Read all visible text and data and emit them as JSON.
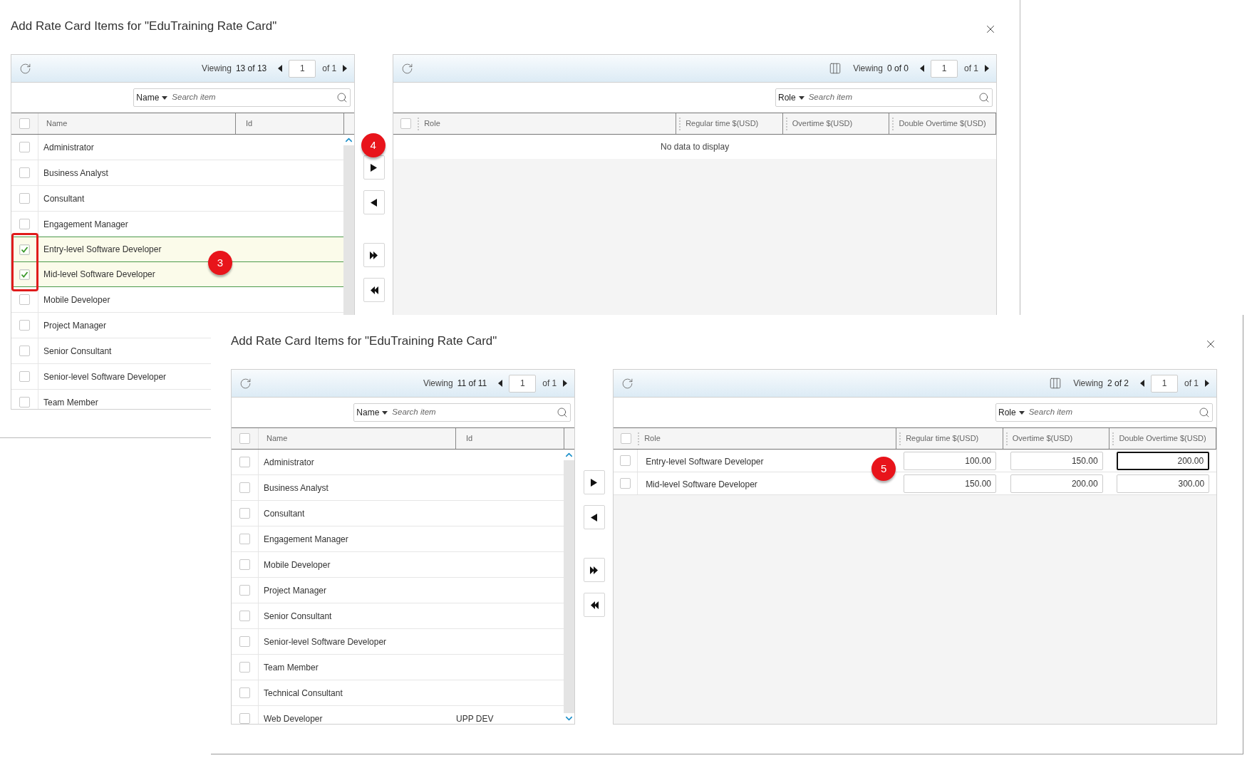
{
  "dialogs": [
    {
      "title": "Add Rate Card Items for \"EduTraining Rate Card\"",
      "selection_outline": true,
      "left_grid": {
        "all_checked": false,
        "viewing": "Viewing",
        "count": "13 of 13",
        "page": "1",
        "page_total": "of 1",
        "search": {
          "filter": "Name",
          "placeholder": "Search item"
        },
        "columns": [
          "Name",
          "Id"
        ],
        "callout": "3",
        "rows": [
          {
            "name": "Administrator",
            "checked": false
          },
          {
            "name": "Business Analyst",
            "checked": false
          },
          {
            "name": "Consultant",
            "checked": false
          },
          {
            "name": "Engagement Manager",
            "checked": false
          },
          {
            "name": "Entry-level Software Developer",
            "checked": true
          },
          {
            "name": "Mid-level Software Developer",
            "checked": true
          },
          {
            "name": "Mobile Developer",
            "checked": false
          },
          {
            "name": "Project Manager",
            "checked": false
          },
          {
            "name": "Senior Consultant",
            "checked": false
          },
          {
            "name": "Senior-level Software Developer",
            "checked": false
          },
          {
            "name": "Team Member",
            "checked": false
          }
        ]
      },
      "move_buttons": [
        {
          "kind": "add",
          "callout": "4"
        },
        {
          "kind": "remove"
        },
        {
          "kind": "add-all"
        },
        {
          "kind": "remove-all"
        }
      ],
      "right_grid": {
        "all_checked": false,
        "viewing": "Viewing",
        "count": "0 of 0",
        "page": "1",
        "page_total": "of 1",
        "search": {
          "filter": "Role",
          "placeholder": "Search item"
        },
        "columns": [
          "Role",
          "Regular time $(USD)",
          "Overtime $(USD)",
          "Double Overtime $(USD)"
        ],
        "empty_message": "No data to display"
      }
    },
    {
      "title": "Add Rate Card Items for \"EduTraining Rate Card\"",
      "left_grid": {
        "all_checked": false,
        "viewing": "Viewing",
        "count": "11 of 11",
        "page": "1",
        "page_total": "of 1",
        "search": {
          "filter": "Name",
          "placeholder": "Search item"
        },
        "columns": [
          "Name",
          "Id"
        ],
        "rows": [
          {
            "name": "Administrator",
            "checked": false
          },
          {
            "name": "Business Analyst",
            "checked": false
          },
          {
            "name": "Consultant",
            "checked": false
          },
          {
            "name": "Engagement Manager",
            "checked": false
          },
          {
            "name": "Mobile Developer",
            "checked": false
          },
          {
            "name": "Project Manager",
            "checked": false
          },
          {
            "name": "Senior Consultant",
            "checked": false
          },
          {
            "name": "Senior-level Software Developer",
            "checked": false
          },
          {
            "name": "Team Member",
            "checked": false
          },
          {
            "name": "Technical Consultant",
            "checked": false
          },
          {
            "name": "Web Developer",
            "id": "UPP DEV",
            "checked": false
          }
        ]
      },
      "move_buttons": [
        {
          "kind": "add"
        },
        {
          "kind": "remove"
        },
        {
          "kind": "add-all"
        },
        {
          "kind": "remove-all"
        }
      ],
      "right_grid": {
        "all_checked": false,
        "viewing": "Viewing",
        "count": "2 of 2",
        "page": "1",
        "page_total": "of 1",
        "search": {
          "filter": "Role",
          "placeholder": "Search item"
        },
        "columns": [
          "Role",
          "Regular time $(USD)",
          "Overtime $(USD)",
          "Double Overtime $(USD)"
        ],
        "callout": "5",
        "rows": [
          {
            "role": "Entry-level Software Developer",
            "checked": false,
            "values": [
              {
                "value": "100.00",
                "focused": false
              },
              {
                "value": "150.00",
                "focused": false
              },
              {
                "value": "200.00",
                "focused": true
              }
            ]
          },
          {
            "role": "Mid-level Software Developer",
            "checked": false,
            "values": [
              {
                "value": "150.00",
                "focused": false
              },
              {
                "value": "200.00",
                "focused": false
              },
              {
                "value": "300.00",
                "focused": false
              }
            ]
          }
        ]
      }
    }
  ]
}
